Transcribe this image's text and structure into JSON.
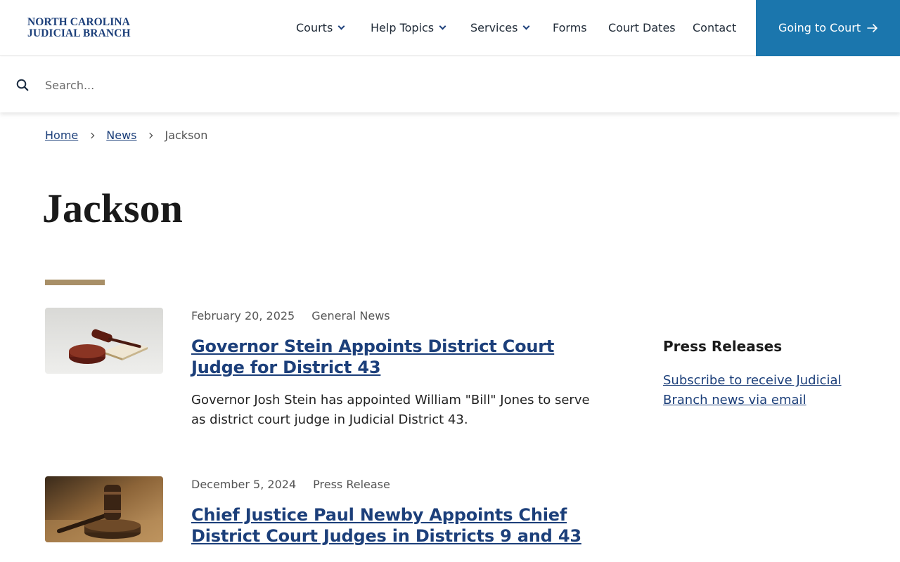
{
  "logo": {
    "line1": "NORTH CAROLINA",
    "line2": "JUDICIAL BRANCH"
  },
  "nav": {
    "items": [
      {
        "label": "Courts",
        "has_dropdown": true
      },
      {
        "label": "Help Topics",
        "has_dropdown": true
      },
      {
        "label": "Services",
        "has_dropdown": true
      },
      {
        "label": "Forms",
        "has_dropdown": false
      },
      {
        "label": "Court Dates",
        "has_dropdown": false
      },
      {
        "label": "Contact",
        "has_dropdown": false
      }
    ],
    "cta_label": "Going to Court"
  },
  "search": {
    "placeholder": "Search..."
  },
  "breadcrumb": {
    "home": "Home",
    "news": "News",
    "current": "Jackson"
  },
  "page": {
    "title": "Jackson"
  },
  "articles": [
    {
      "date": "February 20, 2025",
      "category": "General News",
      "title": "Governor Stein Appoints District Court Judge for District 43",
      "summary": "Governor Josh Stein has appointed William \"Bill\" Jones to serve as district court judge in Judicial District 43.",
      "image": "gavel-on-book-image"
    },
    {
      "date": "December 5, 2024",
      "category": "Press Release",
      "title": "Chief Justice Paul Newby Appoints Chief District Court Judges in Districts 9 and 43",
      "image": "gavel-on-wood-image"
    }
  ],
  "sidebar": {
    "heading": "Press Releases",
    "link": "Subscribe to receive Judicial Branch news via email"
  },
  "colors": {
    "brand_blue": "#1c3f7a",
    "cta_blue": "#1b76ad",
    "accent_tan": "#a88f67"
  }
}
